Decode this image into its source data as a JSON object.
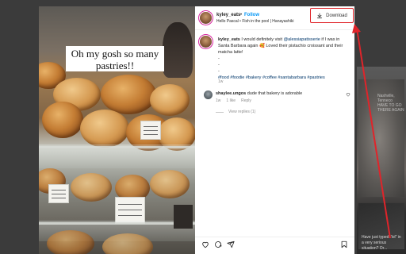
{
  "background": {
    "right_overlay_text": "Nashville, Tenneco\nHAVE TO GO\nTHERE AGAIN",
    "right_caption": "Have just typed \"lol\" in a very serious situation? Or..."
  },
  "media": {
    "overlay_text": "Oh my gosh so many pastries!!"
  },
  "post": {
    "author": "kyley_eats",
    "follow_label": "Follow",
    "audio_line": "Hello Pascal • Fish in the pool | Hanayashiki",
    "caption": {
      "author": "kyley_eats",
      "text_before_mention": "I would definitely visit",
      "mention": "@alessiapatisserie",
      "text_after_mention": "if I was in Santa Barbara again 🥰 Loved their pistachio croissant and their matcha latte!",
      "dashes": [
        "-",
        "-",
        "-"
      ],
      "hashtags": "#food #foodie #bakery #coffee #santabarbara #pastries",
      "time": "1w"
    },
    "comment": {
      "author": "shaylee.ungos",
      "text": "dude that bakery is adorable",
      "time": "1w",
      "likes": "1 like",
      "reply_label": "Reply",
      "view_replies": "View replies (1)"
    }
  },
  "download_button": {
    "label": "Download",
    "accent_color": "#e0242a"
  },
  "icons": [
    "download-icon",
    "heart-icon",
    "comment-icon",
    "share-icon",
    "bookmark-icon"
  ]
}
